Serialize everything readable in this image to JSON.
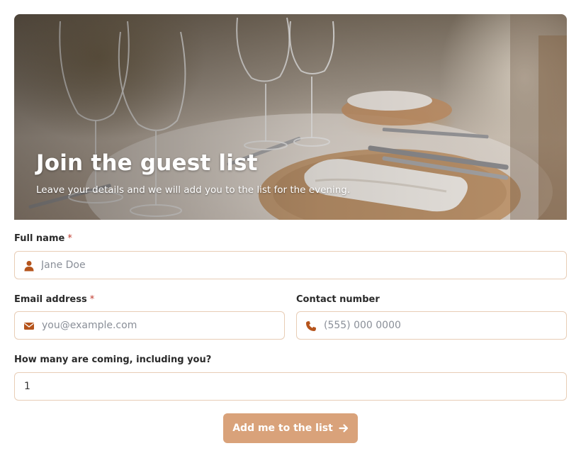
{
  "hero": {
    "title": "Join the guest list",
    "subtitle": "Leave your details and we will add you to the list for the evening."
  },
  "form": {
    "full_name": {
      "label": "Full name",
      "required_mark": "*",
      "placeholder": "Jane Doe",
      "icon": "user-icon"
    },
    "email": {
      "label": "Email address",
      "required_mark": "*",
      "placeholder": "you@example.com",
      "icon": "envelope-icon"
    },
    "phone": {
      "label": "Contact number",
      "placeholder": "(555) 000 0000",
      "icon": "phone-icon"
    },
    "party_size": {
      "label": "How many are coming, including you?",
      "value": "1"
    },
    "submit": {
      "label": "Add me to the list",
      "icon": "arrow-right-icon"
    }
  },
  "colors": {
    "accent": "#d9a27a",
    "icon": "#b5541c",
    "field_border": "#e8cdb6",
    "required": "#c0392b"
  }
}
